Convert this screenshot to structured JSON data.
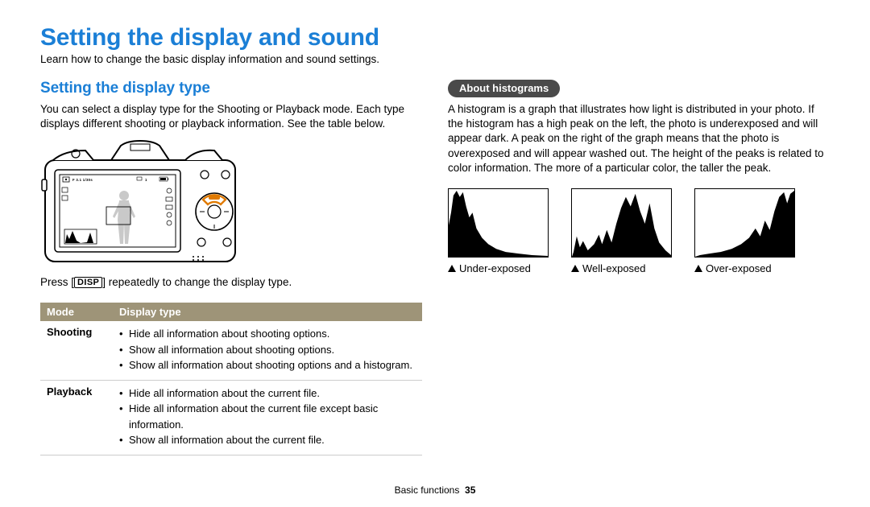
{
  "title": "Setting the display and sound",
  "subtitle": "Learn how to change the basic display information and sound settings.",
  "left": {
    "heading": "Setting the display type",
    "intro": "You can select a display type for the Shooting or Playback mode. Each type displays different shooting or playback information. See the table below.",
    "press_before": "Press [",
    "press_button": "DISP",
    "press_after": "] repeatedly to change the display type.",
    "table": {
      "head_mode": "Mode",
      "head_display": "Display type",
      "rows": [
        {
          "mode": "Shooting",
          "items": [
            "Hide all information about shooting options.",
            "Show all information about shooting options.",
            "Show all information about shooting options and a histogram."
          ]
        },
        {
          "mode": "Playback",
          "items": [
            "Hide all information about the current file.",
            "Hide all information about the current file except basic information.",
            "Show all information about the current file."
          ]
        }
      ]
    },
    "camera_screen": {
      "readout": "F 3.1  1/30s",
      "remaining": "1"
    }
  },
  "right": {
    "pill": "About histograms",
    "para": "A histogram is a graph that illustrates how light is distributed in your photo. If the histogram has a high peak on the left, the photo is underexposed and will appear dark. A peak on the right of the graph means that the photo is overexposed and will appear washed out. The height of the peaks is related to color information. The more of a particular color, the taller the peak.",
    "labels": {
      "under": "Under-exposed",
      "well": "Well-exposed",
      "over": "Over-exposed"
    }
  },
  "footer": {
    "section": "Basic functions",
    "page": "35"
  }
}
